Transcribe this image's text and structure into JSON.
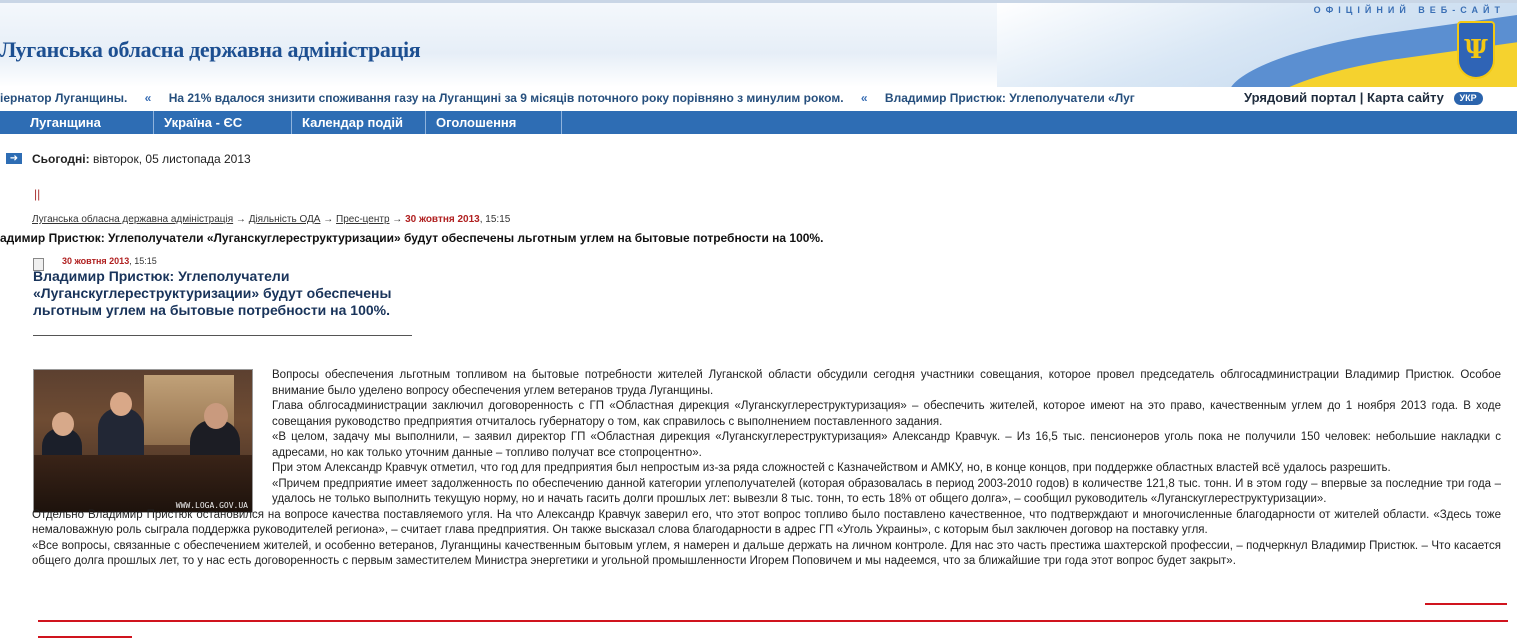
{
  "header": {
    "official": "ОФІЦІЙНИЙ ВЕБ-САЙТ",
    "site_title": "Луганська обласна державна адміністрація"
  },
  "ticker": {
    "items": [
      "іернатор Луганщины.",
      "На 21% вдалося знизити споживання газу на Луганщині за 9 місяців поточного року порівняно з минулим роком.",
      "Владимир Пристюк: Углеполучатели «Луг"
    ],
    "separator": "«"
  },
  "toplinks": {
    "portal": "Урядовий портал",
    "sitemap": "Карта сайту",
    "lang": "УКР"
  },
  "nav": {
    "items": [
      "Луганщина",
      "Україна - ЄС",
      "Календар подій",
      "Оголошення"
    ]
  },
  "today": {
    "label": "Сьогодні:",
    "value": "вівторок, 05 листопада 2013"
  },
  "bars": "||",
  "breadcrumb": {
    "items": [
      "Луганська обласна державна адміністрація",
      "Діяльність ОДА",
      "Прес-центр"
    ],
    "sep": "→",
    "date": "30 жовтня 2013",
    "time": ", 15:15"
  },
  "headline_line": "адимир Пристюк: Углеполучатели «Луганскуглереструктуризации» будут обеспечены льготным углем на бытовые потребности на 100%.",
  "article": {
    "date": "30 жовтня 2013",
    "time": ", 15:15",
    "title": "Владимир Пристюк: Углеполучатели «Луганскуглереструктуризации» будут обеспечены льготным углем на бытовые потребности на 100%.",
    "photo_watermark": "WWW.LOGA.GOV.UA",
    "paragraphs": [
      "Вопросы обеспечения льготным топливом на бытовые потребности жителей Луганской области обсудили сегодня участники совещания, которое провел председатель облгосадминистрации Владимир Пристюк. Особое внимание было уделено вопросу обеспечения углем ветеранов труда Луганщины.",
      "Глава облгосадминистрации заключил договоренность с ГП «Областная дирекция «Луганскуглереструктуризация» – обеспечить жителей, которое имеют на это право, качественным углем до 1 ноября 2013 года. В ходе совещания руководство предприятия отчиталось губернатору о том, как справилось с выполнением поставленного задания.",
      "«В целом, задачу мы выполнили, – заявил директор ГП «Областная дирекция «Луганскуглереструктуризация» Александр Кравчук. – Из 16,5 тыс. пенсионеров уголь пока не получили 150 человек: небольшие накладки с адресами, но как только уточним данные – топливо получат все стопроцентно».",
      "При этом Александр Кравчук отметил, что год для предприятия был непростым из-за ряда сложностей с Казначейством и АМКУ, но, в конце концов, при поддержке областных властей всё удалось разрешить.",
      "«Причем предприятие имеет задолженность по обеспечению данной категории углеполучателей (которая образовалась в период 2003-2010 годов) в количестве 121,8 тыс. тонн. И в этом году – впервые за последние три года – удалось не только выполнить текущую норму, но и начать гасить долги прошлых лет: вывезли 8 тыс. тонн, то есть 18% от общего долга», – сообщил руководитель «Луганскуглереструктуризации».",
      "Отдельно Владимир Пристюк остановился на вопросе качества поставляемого угля. На что Александр Кравчук заверил его, что этот вопрос топливо было поставлено качественное, что подтверждают и многочисленные благодарности от жителей области. «Здесь тоже немаловажную роль сыграла поддержка руководителей региона», – считает глава предприятия. Он также высказал слова благодарности в адрес ГП «Уголь Украины», с которым был заключен договор на поставку угля.",
      "«Все вопросы, связанные с обеспечением жителей, и особенно ветеранов, Луганщины качественным бытовым углем, я намерен и дальше держать на личном контроле. Для нас это часть престижа шахтерской профессии, – подчеркнул Владимир Пристюк. – Что касается общего долга прошлых лет, то у нас есть договоренность с первым заместителем Министра энергетики и угольной промышленности Игорем Поповичем и мы надеемся, что за ближайшие три года этот вопрос будет закрыт»."
    ]
  },
  "colors": {
    "nav_bg": "#2e6db4",
    "title_blue": "#1d4f91",
    "date_red": "#b02020",
    "underline_red": "#d0141e"
  }
}
